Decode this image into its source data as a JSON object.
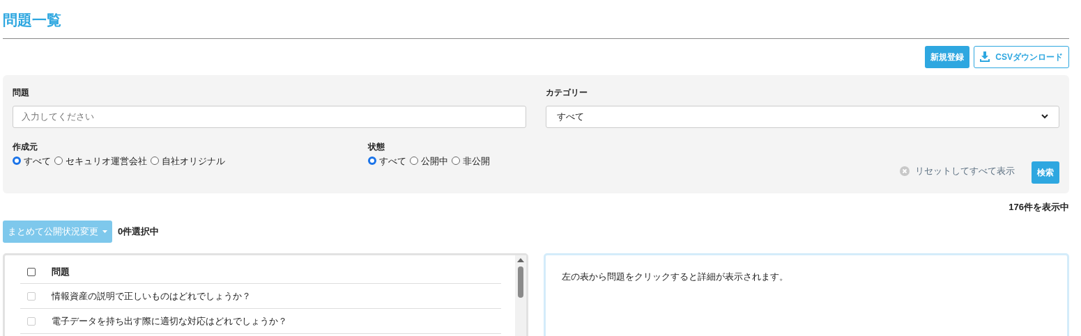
{
  "page_title": "問題一覧",
  "actions": {
    "new_button": "新規登録",
    "csv_button": "CSVダウンロード"
  },
  "filters": {
    "question": {
      "label": "問題",
      "placeholder": "入力してください"
    },
    "category": {
      "label": "カテゴリー",
      "value": "すべて"
    },
    "source": {
      "label": "作成元",
      "options": [
        {
          "label": "すべて",
          "selected": true
        },
        {
          "label": "セキュリオ運営会社",
          "selected": false
        },
        {
          "label": "自社オリジナル",
          "selected": false
        }
      ]
    },
    "status": {
      "label": "状態",
      "options": [
        {
          "label": "すべて",
          "selected": true
        },
        {
          "label": "公開中",
          "selected": false
        },
        {
          "label": "非公開",
          "selected": false
        }
      ]
    },
    "reset_link": "リセットしてすべて表示",
    "search_button": "検索"
  },
  "result_count": "176件を表示中",
  "bulk_button": "まとめて公開状況変更",
  "selected_count": "0件選択中",
  "table": {
    "header": {
      "label": "問題",
      "checked": false
    },
    "rows": [
      {
        "text": "情報資産の説明で正しいものはどれでしょうか？",
        "checked": false
      },
      {
        "text": "電子データを持ち出す際に適切な対応はどれでしょうか？",
        "checked": false
      }
    ]
  },
  "detail_message": "左の表から問題をクリックすると詳細が表示されます。"
}
